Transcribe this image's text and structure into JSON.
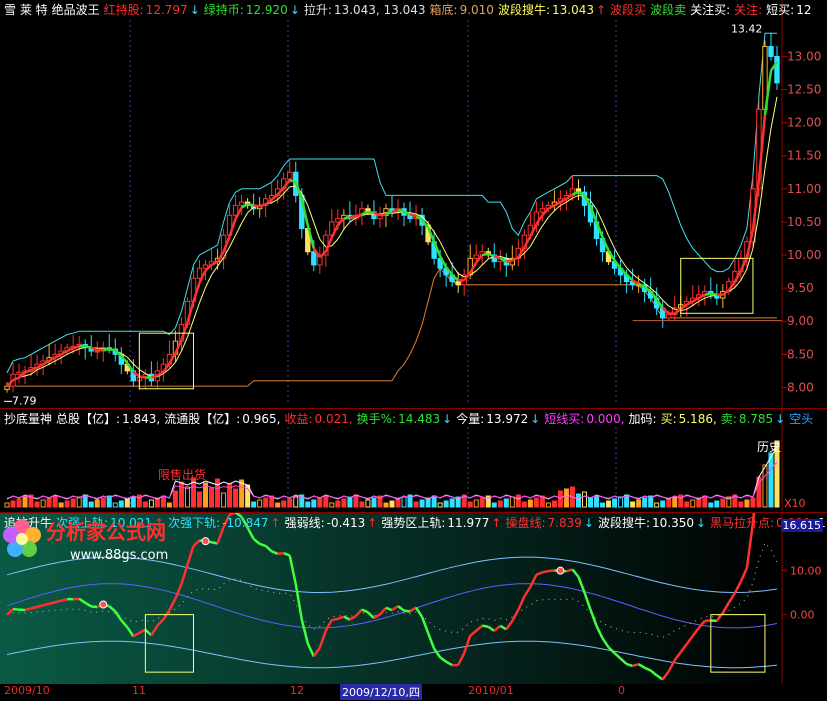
{
  "panel1": {
    "items": [
      {
        "label": "雪 莱 特",
        "color": "#ffffff"
      },
      {
        "label": "绝品波王",
        "color": "#ffffff"
      },
      {
        "label": "红持股:",
        "color": "#ff3030",
        "value": "12.797",
        "arrow": "↓"
      },
      {
        "label": "绿持币:",
        "color": "#30e030",
        "value": "12.920",
        "arrow": "↓"
      },
      {
        "label": "拉升:",
        "color": "#e0e0e0",
        "value": "13.043, 13.043",
        "arrow": ""
      },
      {
        "label": "箱底:",
        "color": "#e0a060",
        "value": "9.010",
        "arrow": ""
      },
      {
        "label": "波段搜牛:",
        "color": "#ffff60",
        "value": "13.043",
        "arrow": "↑"
      },
      {
        "label": "波段买",
        "color": "#ff3030",
        "value": "",
        "arrow": ""
      },
      {
        "label": "波段卖",
        "color": "#30e030",
        "value": "",
        "arrow": ""
      },
      {
        "label": "关注买:",
        "color": "#ffffff",
        "value": "",
        "arrow": ""
      },
      {
        "label": "关注:",
        "color": "#ff3030",
        "value": "",
        "arrow": ""
      },
      {
        "label": "短买:",
        "color": "#ffffff",
        "value": "12",
        "arrow": ""
      }
    ],
    "peak_label": "13.42",
    "low_label": "7.79",
    "y_ticks": [
      "13.00",
      "12.50",
      "12.00",
      "11.50",
      "11.00",
      "10.50",
      "10.00",
      "9.50",
      "9.00",
      "8.50",
      "8.00"
    ]
  },
  "panel2": {
    "items": [
      {
        "label": "抄底量神",
        "color": "#ffffff",
        "value": ""
      },
      {
        "label": "总股【亿】:",
        "color": "#ffffff",
        "value": "1.843,"
      },
      {
        "label": "流通股【亿】:",
        "color": "#ffffff",
        "value": "0.965,"
      },
      {
        "label": "收益:",
        "color": "#ff3030",
        "value": "0.021,"
      },
      {
        "label": "换手%:",
        "color": "#30e030",
        "value": "14.483",
        "arrow": "↓"
      },
      {
        "label": "今量:",
        "color": "#ffffff",
        "value": "13.972",
        "arrow": "↓"
      },
      {
        "label": "短线买:",
        "color": "#ff40ff",
        "value": "0.000,"
      },
      {
        "label": "加码:",
        "color": "#ffffff",
        "value": ""
      },
      {
        "label": "买:",
        "color": "#ffff60",
        "value": "5.186,"
      },
      {
        "label": "卖:",
        "color": "#30e030",
        "value": "8.785",
        "arrow": "↓"
      },
      {
        "label": "空头",
        "color": "#30a0ff",
        "value": ""
      }
    ],
    "annotation_left": "限售出货",
    "annotation_right": "历史",
    "x10": "X10"
  },
  "panel3": {
    "items": [
      {
        "label": "追拉升牛",
        "color": "#ffffff",
        "value": ""
      },
      {
        "label": "次强上轨:",
        "color": "#30e0ff",
        "value": "10.021",
        "arrow": "↑"
      },
      {
        "label": "次强下轨:",
        "color": "#30e0ff",
        "value": "-10.847",
        "arrow": "↑"
      },
      {
        "label": "强弱线:",
        "color": "#ffffff",
        "value": "-0.413",
        "arrow": "↑"
      },
      {
        "label": "强势区上轨:",
        "color": "#ffffff",
        "value": "11.977",
        "arrow": "↑"
      },
      {
        "label": "操盘线:",
        "color": "#ff3030",
        "value": "7.839",
        "arrow": "↓"
      },
      {
        "label": "波段搜牛:",
        "color": "#ffffff",
        "value": "10.350",
        "arrow": "↓"
      },
      {
        "label": "黑马拉升点:",
        "color": "#ff3030",
        "value": "0.000,"
      },
      {
        "label": "11",
        "color": "#ffffff",
        "value": ""
      }
    ],
    "badge": "16.615",
    "y_ticks": [
      "10.00",
      "0.00"
    ]
  },
  "xaxis": {
    "ticks": [
      "2009/10",
      "11",
      "12",
      "2010/01",
      "0"
    ],
    "selected": "2009/12/10,四"
  },
  "logo": {
    "brand": "分析家公式网",
    "url": "www.88gs.com"
  },
  "colors": {
    "up": "#ff3030",
    "down": "#30e0ff",
    "ma_green": "#30e030",
    "box": "#ffff70",
    "cyan": "#40e0f0",
    "orange": "#e08030"
  },
  "chart_data": {
    "type": "candlestick",
    "y_range": [
      7.75,
      13.55
    ],
    "close": [
      8.02,
      8.2,
      8.23,
      8.25,
      8.3,
      8.35,
      8.4,
      8.45,
      8.5,
      8.55,
      8.6,
      8.62,
      8.65,
      8.6,
      8.55,
      8.55,
      8.6,
      8.58,
      8.5,
      8.35,
      8.25,
      8.1,
      8.15,
      8.2,
      8.1,
      8.25,
      8.35,
      8.5,
      8.7,
      8.95,
      9.3,
      9.65,
      9.8,
      9.85,
      9.9,
      9.95,
      10.3,
      10.6,
      10.75,
      10.8,
      10.75,
      10.7,
      10.75,
      10.85,
      10.9,
      11.0,
      11.15,
      11.25,
      10.9,
      10.4,
      10.05,
      9.85,
      10.0,
      10.3,
      10.5,
      10.55,
      10.6,
      10.55,
      10.6,
      10.7,
      10.65,
      10.55,
      10.6,
      10.7,
      10.65,
      10.7,
      10.6,
      10.55,
      10.6,
      10.45,
      10.2,
      9.95,
      9.8,
      9.7,
      9.6,
      9.55,
      9.7,
      9.95,
      10.0,
      10.05,
      10.0,
      9.9,
      9.95,
      9.85,
      9.95,
      10.1,
      10.3,
      10.45,
      10.65,
      10.7,
      10.75,
      10.8,
      10.85,
      10.9,
      11.0,
      10.95,
      10.75,
      10.5,
      10.25,
      10.05,
      9.9,
      9.8,
      9.7,
      9.6,
      9.55,
      9.55,
      9.45,
      9.35,
      9.2,
      9.05,
      9.1,
      9.2,
      9.25,
      9.3,
      9.35,
      9.4,
      9.45,
      9.4,
      9.35,
      9.45,
      9.6,
      9.75,
      9.95,
      10.2,
      11.0,
      12.2,
      13.15,
      13.0,
      12.6
    ],
    "dates": [
      "2009/10",
      "11",
      "12",
      "2010/01"
    ]
  }
}
